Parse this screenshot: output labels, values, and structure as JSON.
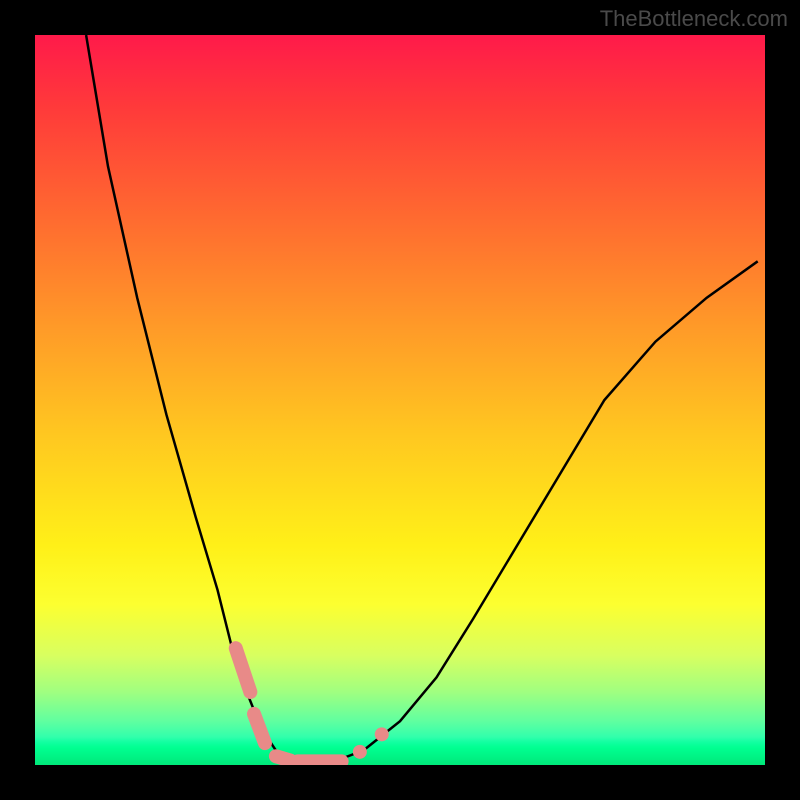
{
  "watermark": "TheBottleneck.com",
  "chart_data": {
    "type": "line",
    "title": "",
    "xlabel": "",
    "ylabel": "",
    "xlim": [
      0,
      100
    ],
    "ylim": [
      0,
      100
    ],
    "series": [
      {
        "name": "curve",
        "x": [
          7,
          10,
          14,
          18,
          22,
          25,
          27,
          29,
          31,
          33,
          37,
          41,
          45,
          50,
          55,
          60,
          66,
          72,
          78,
          85,
          92,
          99
        ],
        "y": [
          100,
          82,
          64,
          48,
          34,
          24,
          16,
          10,
          5,
          2,
          0.5,
          0.5,
          2,
          6,
          12,
          20,
          30,
          40,
          50,
          58,
          64,
          69
        ]
      }
    ],
    "markers": [
      {
        "kind": "pill",
        "x1": 27.5,
        "y1": 16,
        "x2": 29.5,
        "y2": 10
      },
      {
        "kind": "pill",
        "x1": 30,
        "y1": 7,
        "x2": 31.5,
        "y2": 3
      },
      {
        "kind": "pill",
        "x1": 33,
        "y1": 1.2,
        "x2": 35,
        "y2": 0.6
      },
      {
        "kind": "pill",
        "x1": 36,
        "y1": 0.5,
        "x2": 42,
        "y2": 0.5
      },
      {
        "kind": "point",
        "x": 44.5,
        "y": 1.8
      },
      {
        "kind": "point",
        "x": 47.5,
        "y": 4.2
      }
    ],
    "background_gradient": {
      "top": "#ff1a4a",
      "mid": "#fff018",
      "bottom": "#00ff90"
    }
  }
}
